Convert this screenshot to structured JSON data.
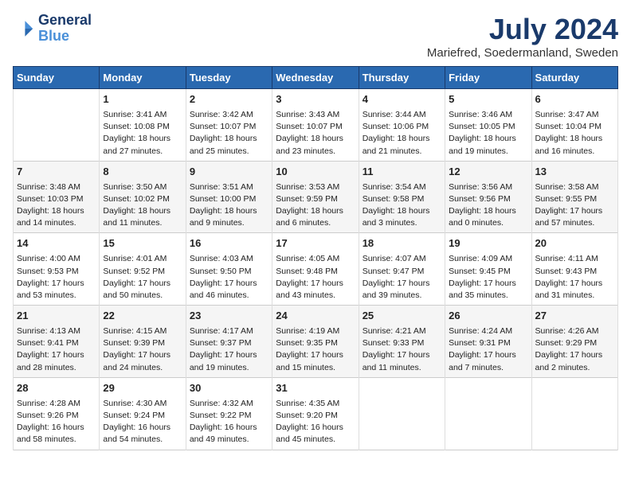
{
  "logo": {
    "line1": "General",
    "line2": "Blue"
  },
  "title": "July 2024",
  "subtitle": "Mariefred, Soedermanland, Sweden",
  "days_header": [
    "Sunday",
    "Monday",
    "Tuesday",
    "Wednesday",
    "Thursday",
    "Friday",
    "Saturday"
  ],
  "weeks": [
    [
      {
        "day": "",
        "content": ""
      },
      {
        "day": "1",
        "content": "Sunrise: 3:41 AM\nSunset: 10:08 PM\nDaylight: 18 hours\nand 27 minutes."
      },
      {
        "day": "2",
        "content": "Sunrise: 3:42 AM\nSunset: 10:07 PM\nDaylight: 18 hours\nand 25 minutes."
      },
      {
        "day": "3",
        "content": "Sunrise: 3:43 AM\nSunset: 10:07 PM\nDaylight: 18 hours\nand 23 minutes."
      },
      {
        "day": "4",
        "content": "Sunrise: 3:44 AM\nSunset: 10:06 PM\nDaylight: 18 hours\nand 21 minutes."
      },
      {
        "day": "5",
        "content": "Sunrise: 3:46 AM\nSunset: 10:05 PM\nDaylight: 18 hours\nand 19 minutes."
      },
      {
        "day": "6",
        "content": "Sunrise: 3:47 AM\nSunset: 10:04 PM\nDaylight: 18 hours\nand 16 minutes."
      }
    ],
    [
      {
        "day": "7",
        "content": "Sunrise: 3:48 AM\nSunset: 10:03 PM\nDaylight: 18 hours\nand 14 minutes."
      },
      {
        "day": "8",
        "content": "Sunrise: 3:50 AM\nSunset: 10:02 PM\nDaylight: 18 hours\nand 11 minutes."
      },
      {
        "day": "9",
        "content": "Sunrise: 3:51 AM\nSunset: 10:00 PM\nDaylight: 18 hours\nand 9 minutes."
      },
      {
        "day": "10",
        "content": "Sunrise: 3:53 AM\nSunset: 9:59 PM\nDaylight: 18 hours\nand 6 minutes."
      },
      {
        "day": "11",
        "content": "Sunrise: 3:54 AM\nSunset: 9:58 PM\nDaylight: 18 hours\nand 3 minutes."
      },
      {
        "day": "12",
        "content": "Sunrise: 3:56 AM\nSunset: 9:56 PM\nDaylight: 18 hours\nand 0 minutes."
      },
      {
        "day": "13",
        "content": "Sunrise: 3:58 AM\nSunset: 9:55 PM\nDaylight: 17 hours\nand 57 minutes."
      }
    ],
    [
      {
        "day": "14",
        "content": "Sunrise: 4:00 AM\nSunset: 9:53 PM\nDaylight: 17 hours\nand 53 minutes."
      },
      {
        "day": "15",
        "content": "Sunrise: 4:01 AM\nSunset: 9:52 PM\nDaylight: 17 hours\nand 50 minutes."
      },
      {
        "day": "16",
        "content": "Sunrise: 4:03 AM\nSunset: 9:50 PM\nDaylight: 17 hours\nand 46 minutes."
      },
      {
        "day": "17",
        "content": "Sunrise: 4:05 AM\nSunset: 9:48 PM\nDaylight: 17 hours\nand 43 minutes."
      },
      {
        "day": "18",
        "content": "Sunrise: 4:07 AM\nSunset: 9:47 PM\nDaylight: 17 hours\nand 39 minutes."
      },
      {
        "day": "19",
        "content": "Sunrise: 4:09 AM\nSunset: 9:45 PM\nDaylight: 17 hours\nand 35 minutes."
      },
      {
        "day": "20",
        "content": "Sunrise: 4:11 AM\nSunset: 9:43 PM\nDaylight: 17 hours\nand 31 minutes."
      }
    ],
    [
      {
        "day": "21",
        "content": "Sunrise: 4:13 AM\nSunset: 9:41 PM\nDaylight: 17 hours\nand 28 minutes."
      },
      {
        "day": "22",
        "content": "Sunrise: 4:15 AM\nSunset: 9:39 PM\nDaylight: 17 hours\nand 24 minutes."
      },
      {
        "day": "23",
        "content": "Sunrise: 4:17 AM\nSunset: 9:37 PM\nDaylight: 17 hours\nand 19 minutes."
      },
      {
        "day": "24",
        "content": "Sunrise: 4:19 AM\nSunset: 9:35 PM\nDaylight: 17 hours\nand 15 minutes."
      },
      {
        "day": "25",
        "content": "Sunrise: 4:21 AM\nSunset: 9:33 PM\nDaylight: 17 hours\nand 11 minutes."
      },
      {
        "day": "26",
        "content": "Sunrise: 4:24 AM\nSunset: 9:31 PM\nDaylight: 17 hours\nand 7 minutes."
      },
      {
        "day": "27",
        "content": "Sunrise: 4:26 AM\nSunset: 9:29 PM\nDaylight: 17 hours\nand 2 minutes."
      }
    ],
    [
      {
        "day": "28",
        "content": "Sunrise: 4:28 AM\nSunset: 9:26 PM\nDaylight: 16 hours\nand 58 minutes."
      },
      {
        "day": "29",
        "content": "Sunrise: 4:30 AM\nSunset: 9:24 PM\nDaylight: 16 hours\nand 54 minutes."
      },
      {
        "day": "30",
        "content": "Sunrise: 4:32 AM\nSunset: 9:22 PM\nDaylight: 16 hours\nand 49 minutes."
      },
      {
        "day": "31",
        "content": "Sunrise: 4:35 AM\nSunset: 9:20 PM\nDaylight: 16 hours\nand 45 minutes."
      },
      {
        "day": "",
        "content": ""
      },
      {
        "day": "",
        "content": ""
      },
      {
        "day": "",
        "content": ""
      }
    ]
  ]
}
